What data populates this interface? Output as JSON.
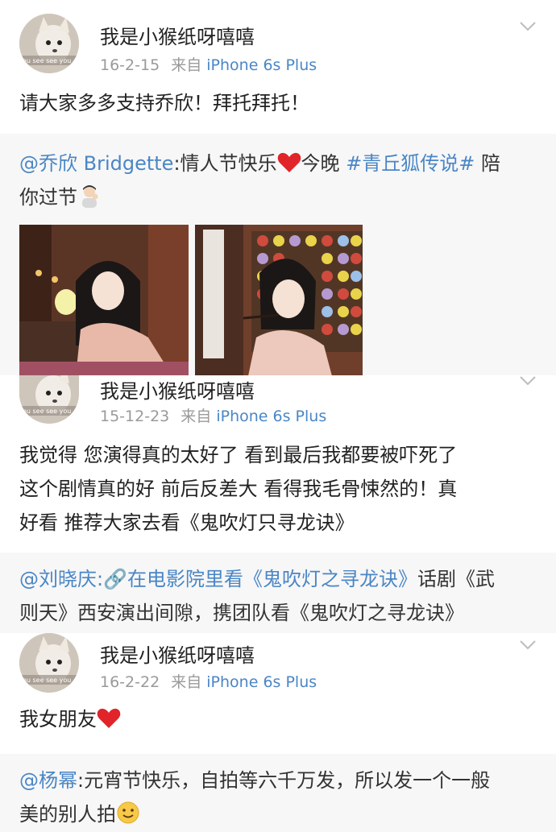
{
  "posts": [
    {
      "username": "我是小猴纸呀嘻嘻",
      "date": "16-2-15",
      "from_label": "来自",
      "device": "iPhone 6s Plus",
      "body": "请大家多多支持乔欣！拜托拜托！",
      "quote": {
        "mention": "@乔欣 Bridgette",
        "text_before": ":情人节快乐",
        "text_middle": "今晚",
        "hashtag": "#青丘狐传说#",
        "text_after_line1": " 陪",
        "text_line2": "你过节"
      }
    },
    {
      "username": "我是小猴纸呀嘻嘻",
      "date": "15-12-23",
      "from_label": "来自",
      "device": "iPhone 6s Plus",
      "body_lines": [
        "我觉得 您演得真的太好了 看到最后我都要被吓死了",
        "这个剧情真的好 前后反差大 看得我毛骨悚然的！真",
        "好看 推荐大家去看《鬼吹灯只寻龙诀》"
      ],
      "quote": {
        "mention": "@刘晓庆",
        "link_text": ":🔗在电影院里看《鬼吹灯之寻龙诀》",
        "line1_rest": "话剧《武",
        "line2": "则天》西安演出间隙，携团队看《鬼吹灯之寻龙诀》"
      }
    },
    {
      "username": "我是小猴纸呀嘻嘻",
      "date": "16-2-22",
      "from_label": "来自",
      "device": "iPhone 6s Plus",
      "body": "我女朋友",
      "quote": {
        "mention": "@杨幂",
        "line1": ":元宵节快乐，自拍等六千万发，所以发一个一般",
        "line2": "美的别人拍"
      }
    }
  ],
  "avatar_text": "ou see see you",
  "icons": [
    "chevron-down-icon",
    "heart-icon",
    "person-emoji-icon",
    "smile-emoji-icon",
    "link-icon"
  ],
  "colors": {
    "link": "#4a86c6",
    "meta": "#9a9a9a",
    "quote_bg": "#f7f7f7",
    "heart": "#e0242a"
  }
}
